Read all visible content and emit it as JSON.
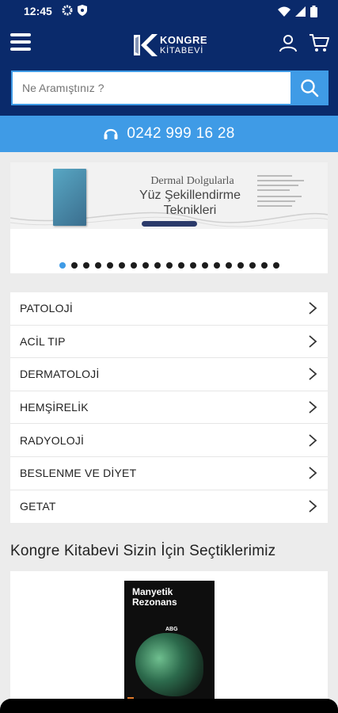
{
  "status_bar": {
    "time": "12:45"
  },
  "header": {
    "logo_line1": "KONGRE",
    "logo_line2": "KİTABEVİ"
  },
  "search": {
    "placeholder": "Ne Aramıştınız ?",
    "value": ""
  },
  "phone": {
    "number": "0242 999 16 28"
  },
  "banner": {
    "line1": "Dermal Dolgularla",
    "line2": "Yüz Şekillendirme",
    "line3": "Teknikleri",
    "slide_count": 19,
    "active_slide": 0
  },
  "categories": [
    {
      "label": "PATOLOJİ"
    },
    {
      "label": "ACİL TIP"
    },
    {
      "label": "DERMATOLOJİ"
    },
    {
      "label": "HEMŞİRELİK"
    },
    {
      "label": "RADYOLOJİ"
    },
    {
      "label": "BESLENME VE DİYET"
    },
    {
      "label": "GETAT"
    }
  ],
  "featured": {
    "title": "Kongre Kitabevi  Sizin İçin Seçtiklerimiz"
  },
  "product": {
    "cover_title": "Manyetik Rezonans",
    "cover_subtitle": "ABG"
  },
  "colors": {
    "navy": "#0a2a6b",
    "accent": "#3f9be6",
    "background": "#ececec"
  }
}
